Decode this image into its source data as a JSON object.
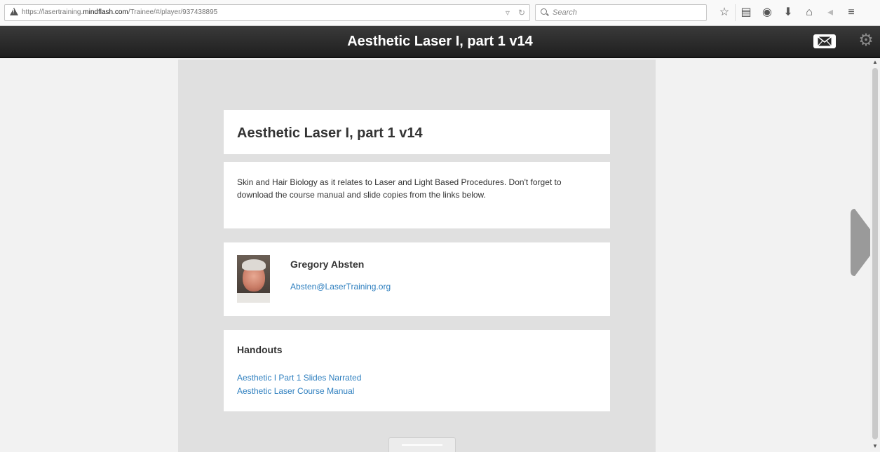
{
  "browser": {
    "url_prefix": "https://lasertraining.",
    "url_host": "mindflash.com",
    "url_path": "/Trainee/#/player/937438895",
    "search_placeholder": "Search"
  },
  "header": {
    "title": "Aesthetic Laser I, part 1 v14"
  },
  "course": {
    "title": "Aesthetic Laser I, part 1 v14",
    "description": "Skin and Hair Biology as it relates to Laser and Light Based Procedures. Don't forget to download the course manual and slide copies from the links below."
  },
  "author": {
    "name": "Gregory Absten",
    "email": "Absten@LaserTraining.org"
  },
  "handouts": {
    "title": "Handouts",
    "items": [
      {
        "label": "Aesthetic I Part 1 Slides Narrated"
      },
      {
        "label": "Aesthetic Laser Course Manual"
      }
    ]
  },
  "icons": {
    "mail": "mail-icon",
    "settings": "gear-icon",
    "next": "next-arrow-icon"
  },
  "colors": {
    "header_bg": "#2a2a2a",
    "link": "#2e7fbf",
    "panel_bg": "#e0e0e0"
  }
}
